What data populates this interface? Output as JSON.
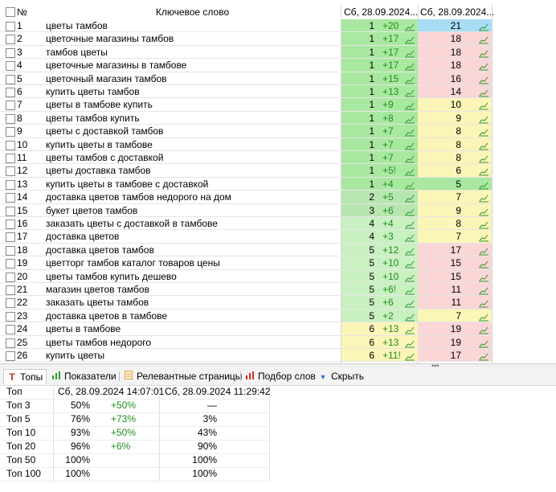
{
  "columns": {
    "num": "№",
    "keyword": "Ключевое слово",
    "date1": "Сб, 28.09.2024...",
    "date2": "Сб, 28.09.2024..."
  },
  "rows": [
    {
      "num": "1",
      "kw": "цветы тамбов",
      "p1": "1",
      "d1": "+20",
      "p2": "21"
    },
    {
      "num": "2",
      "kw": "цветочные магазины тамбов",
      "p1": "1",
      "d1": "+17",
      "p2": "18"
    },
    {
      "num": "3",
      "kw": "тамбов цветы",
      "p1": "1",
      "d1": "+17",
      "p2": "18"
    },
    {
      "num": "4",
      "kw": "цветочные магазины в тамбове",
      "p1": "1",
      "d1": "+17",
      "p2": "18"
    },
    {
      "num": "5",
      "kw": "цветочный магазин тамбов",
      "p1": "1",
      "d1": "+15",
      "p2": "16"
    },
    {
      "num": "6",
      "kw": "купить цветы тамбов",
      "p1": "1",
      "d1": "+13",
      "p2": "14"
    },
    {
      "num": "7",
      "kw": "цветы в тамбове купить",
      "p1": "1",
      "d1": "+9",
      "p2": "10"
    },
    {
      "num": "8",
      "kw": "цветы тамбов купить",
      "p1": "1",
      "d1": "+8",
      "p2": "9"
    },
    {
      "num": "9",
      "kw": "цветы с доставкой тамбов",
      "p1": "1",
      "d1": "+7",
      "p2": "8"
    },
    {
      "num": "10",
      "kw": "купить цветы в тамбове",
      "p1": "1",
      "d1": "+7",
      "p2": "8"
    },
    {
      "num": "11",
      "kw": "цветы тамбов с доставкой",
      "p1": "1",
      "d1": "+7",
      "p2": "8"
    },
    {
      "num": "12",
      "kw": "цветы доставка тамбов",
      "p1": "1",
      "d1": "+5!",
      "p2": "6"
    },
    {
      "num": "13",
      "kw": "купить цветы в тамбове с доставкой",
      "p1": "1",
      "d1": "+4",
      "p2": "5"
    },
    {
      "num": "14",
      "kw": "доставка цветов тамбов недорого на дом",
      "p1": "2",
      "d1": "+5",
      "p2": "7"
    },
    {
      "num": "15",
      "kw": "букет цветов тамбов",
      "p1": "3",
      "d1": "+6",
      "p2": "9"
    },
    {
      "num": "16",
      "kw": "заказать цветы с доставкой в тамбове",
      "p1": "4",
      "d1": "+4",
      "p2": "8"
    },
    {
      "num": "17",
      "kw": "доставка цветов",
      "p1": "4",
      "d1": "+3",
      "p2": "7"
    },
    {
      "num": "18",
      "kw": "доставка цветов тамбов",
      "p1": "5",
      "d1": "+12",
      "p2": "17"
    },
    {
      "num": "19",
      "kw": "цветторг тамбов каталог товаров цены",
      "p1": "5",
      "d1": "+10",
      "p2": "15"
    },
    {
      "num": "20",
      "kw": "цветы тамбов купить дешево",
      "p1": "5",
      "d1": "+10",
      "p2": "15"
    },
    {
      "num": "21",
      "kw": "магазин цветов тамбов",
      "p1": "5",
      "d1": "+6!",
      "p2": "11"
    },
    {
      "num": "22",
      "kw": "заказать цветы тамбов",
      "p1": "5",
      "d1": "+6",
      "p2": "11"
    },
    {
      "num": "23",
      "kw": "доставка цветов в тамбове",
      "p1": "5",
      "d1": "+2",
      "p2": "7"
    },
    {
      "num": "24",
      "kw": "цветы в тамбове",
      "p1": "6",
      "d1": "+13",
      "p2": "19"
    },
    {
      "num": "25",
      "kw": "цветы тамбов недорого",
      "p1": "6",
      "d1": "+13",
      "p2": "19"
    },
    {
      "num": "26",
      "kw": "купить цветы",
      "p1": "6",
      "d1": "+11!",
      "p2": "17"
    }
  ],
  "tabs": [
    {
      "label": "Топы",
      "icon": "T-icon"
    },
    {
      "label": "Показатели",
      "icon": "bar-chart-icon"
    },
    {
      "label": "Релевантные страницы",
      "icon": "page-icon"
    },
    {
      "label": "Подбор слов",
      "icon": "bar-chart-red-icon"
    },
    {
      "label": "Скрыть",
      "icon": "triangle-down-icon"
    }
  ],
  "tops": {
    "header": {
      "name": "Топ",
      "col1": "Сб, 28.09.2024 14:07:01",
      "col2": "Сб, 28.09.2024 11:29:42"
    },
    "rows": [
      {
        "name": "Топ 3",
        "v1": "50%",
        "d": "+50%",
        "v2": "—"
      },
      {
        "name": "Топ 5",
        "v1": "76%",
        "d": "+73%",
        "v2": "3%"
      },
      {
        "name": "Топ 10",
        "v1": "93%",
        "d": "+50%",
        "v2": "43%"
      },
      {
        "name": "Топ 20",
        "v1": "96%",
        "d": "+6%",
        "v2": "90%"
      },
      {
        "name": "Топ 50",
        "v1": "100%",
        "d": "",
        "v2": "100%"
      },
      {
        "name": "Топ 100",
        "v1": "100%",
        "d": "",
        "v2": "100%"
      }
    ]
  },
  "colors": {
    "green1": "#a9e8a0",
    "green2": "#c9f0c0",
    "green3": "#b8e6b0",
    "yellow": "#fbf5b8",
    "pink": "#fad6d6",
    "blue": "#a8dcf2",
    "delta": "#1e8f1e",
    "trend": "#2e9a2e"
  }
}
